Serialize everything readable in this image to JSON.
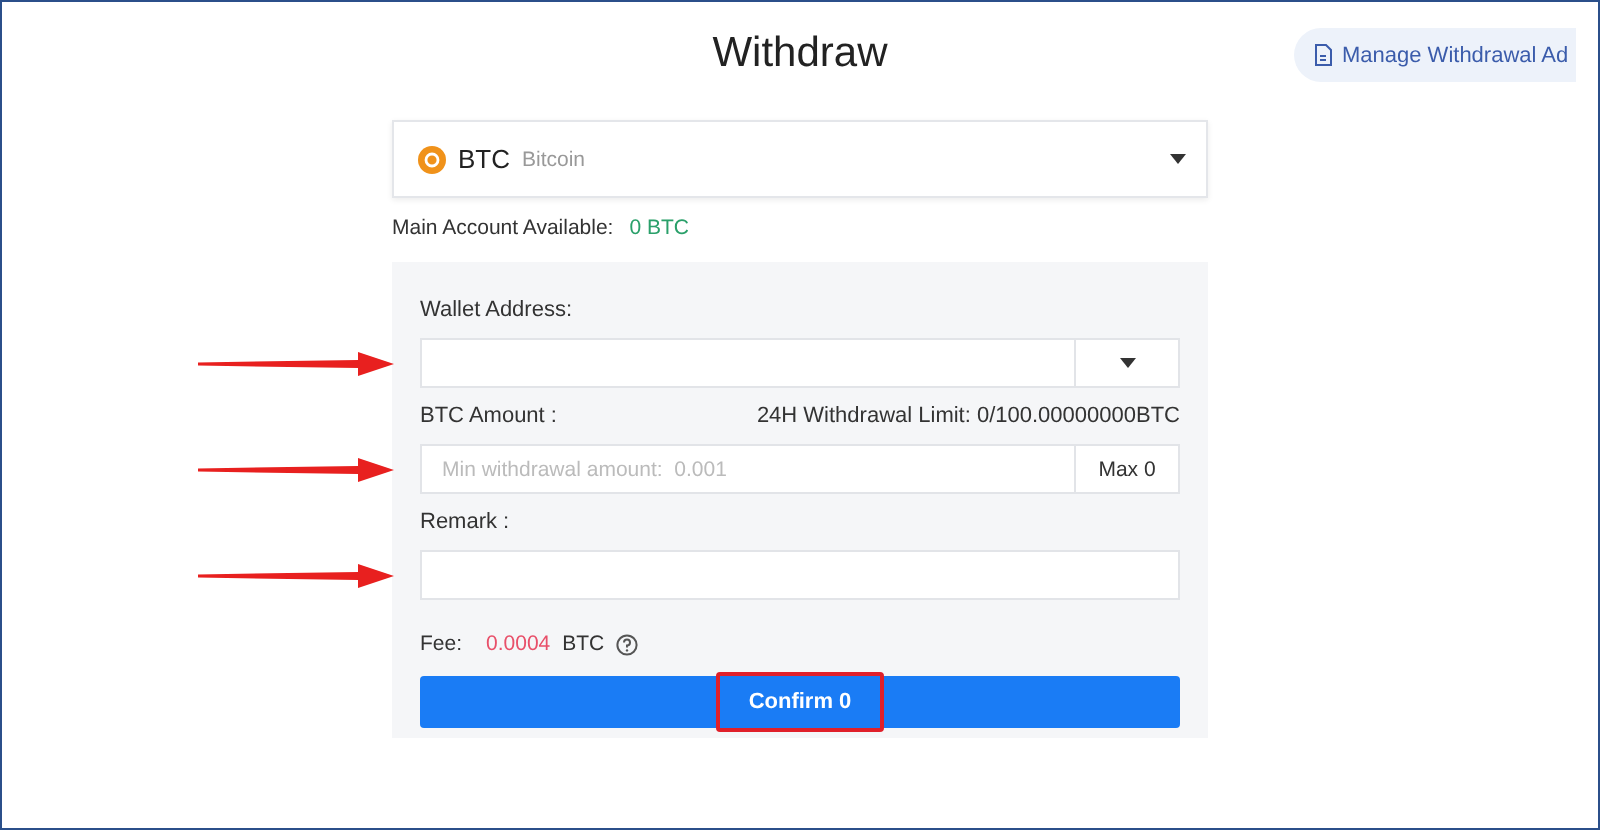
{
  "title": "Withdraw",
  "manage_button": {
    "label": "Manage Withdrawal Ad"
  },
  "coin_select": {
    "symbol": "BTC",
    "name": "Bitcoin"
  },
  "available": {
    "label": "Main Account Available:",
    "value": "0 BTC"
  },
  "fields": [
    {
      "kind": "dropdown",
      "label": "Wallet Address:",
      "marked": true
    },
    {
      "kind": "amount",
      "label": "BTC Amount :",
      "limit": "24H Withdrawal Limit: 0/100.00000000BTC",
      "placeholder": "Min withdrawal amount:  0.001",
      "button": "Max 0",
      "marked": true
    },
    {
      "kind": "text",
      "label": "Remark :",
      "marked": true
    }
  ],
  "fee": {
    "label": "Fee:",
    "value": "0.0004",
    "unit": "BTC"
  },
  "confirm": {
    "label": "Confirm 0",
    "highlighted": true
  }
}
